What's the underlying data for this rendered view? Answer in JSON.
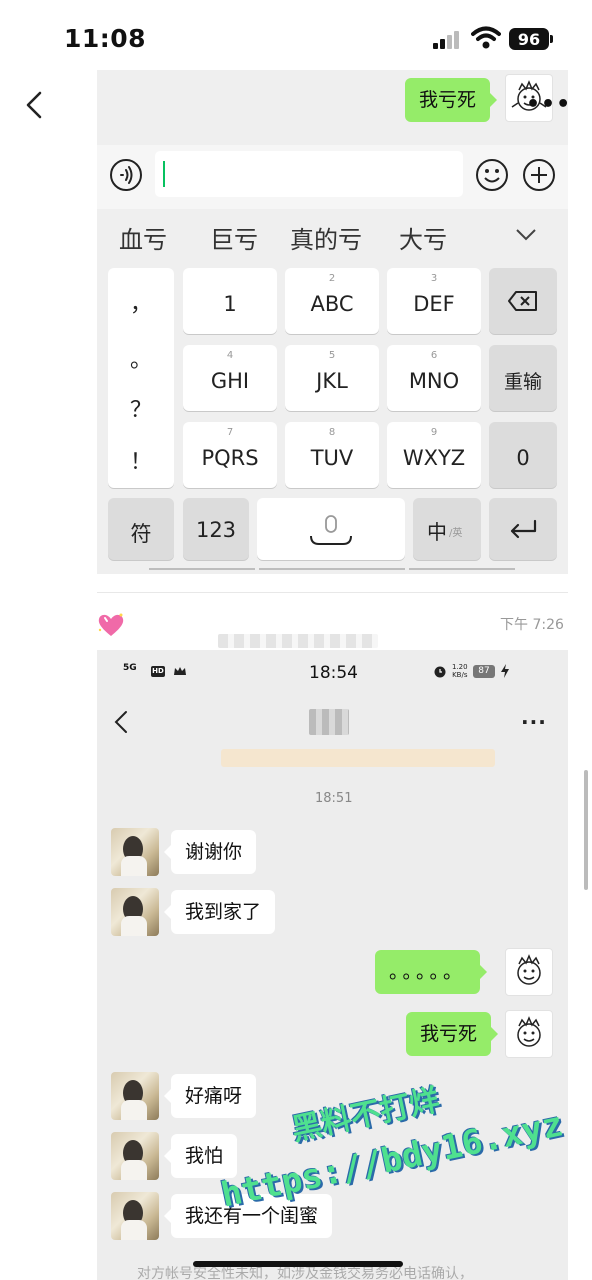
{
  "status_bar": {
    "time": "11:08",
    "battery": "96"
  },
  "top_chat": {
    "sent_message": "我亏死"
  },
  "ime": {
    "candidates": [
      "血亏",
      "巨亏",
      "真的亏",
      "大亏"
    ],
    "punct_keys": [
      "，",
      "。",
      "？",
      "！"
    ],
    "keys": [
      {
        "num": "",
        "label": "1"
      },
      {
        "num": "2",
        "label": "ABC"
      },
      {
        "num": "3",
        "label": "DEF"
      },
      {
        "num": "4",
        "label": "GHI"
      },
      {
        "num": "5",
        "label": "JKL"
      },
      {
        "num": "6",
        "label": "MNO"
      },
      {
        "num": "7",
        "label": "PQRS"
      },
      {
        "num": "8",
        "label": "TUV"
      },
      {
        "num": "9",
        "label": "WXYZ"
      }
    ],
    "retype_label": "重输",
    "zero_label": "0",
    "symbols_label": "符",
    "num_label": "123",
    "lang_label": "中",
    "lang_sub": "/英"
  },
  "meta": {
    "timestamp": "下午 7:26"
  },
  "inner": {
    "status_time": "18:54",
    "network": "5G",
    "hd": "HD",
    "speed": "1.20\nKB/s",
    "battery": "87",
    "more": "···",
    "time_label": "18:51",
    "messages": [
      {
        "from": "other",
        "text": "谢谢你"
      },
      {
        "from": "other",
        "text": "我到家了"
      },
      {
        "from": "me",
        "text": "。。。。。"
      },
      {
        "from": "me",
        "text": "我亏死"
      },
      {
        "from": "other",
        "text": "好痛呀"
      },
      {
        "from": "other",
        "text": "我怕"
      },
      {
        "from": "other",
        "text": "我还有一个闺蜜"
      }
    ],
    "footer": "对方帐号安全性未知，如涉及金钱交易务必电话确认，"
  },
  "watermark": {
    "line1": "黑料不打烊",
    "line2": "https://bdy16.xyz"
  },
  "colors": {
    "sent_bubble": "#95ec69",
    "accent": "#07c160"
  }
}
